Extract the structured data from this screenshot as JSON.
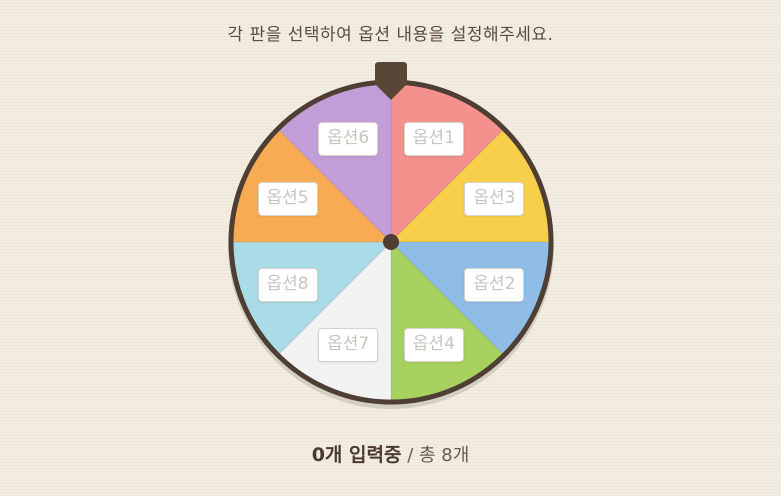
{
  "instruction": "각 판을 선택하여 옵션 내용을 설정해주세요.",
  "wheel": {
    "border_color": "#4f3e33",
    "pointer_color": "#5a4637",
    "segments": [
      {
        "label": "옵션1",
        "color": "#f4918c"
      },
      {
        "label": "옵션3",
        "color": "#f8cf4a"
      },
      {
        "label": "옵션2",
        "color": "#8fbde6"
      },
      {
        "label": "옵션4",
        "color": "#a7d15e"
      },
      {
        "label": "옵션7",
        "color": "#f2f2f2"
      },
      {
        "label": "옵션8",
        "color": "#a9dce6"
      },
      {
        "label": "옵션5",
        "color": "#f7ac54"
      },
      {
        "label": "옵션6",
        "color": "#c29ed8"
      }
    ]
  },
  "counter": {
    "entered": "0개 입력중",
    "total": " / 총 8개"
  }
}
